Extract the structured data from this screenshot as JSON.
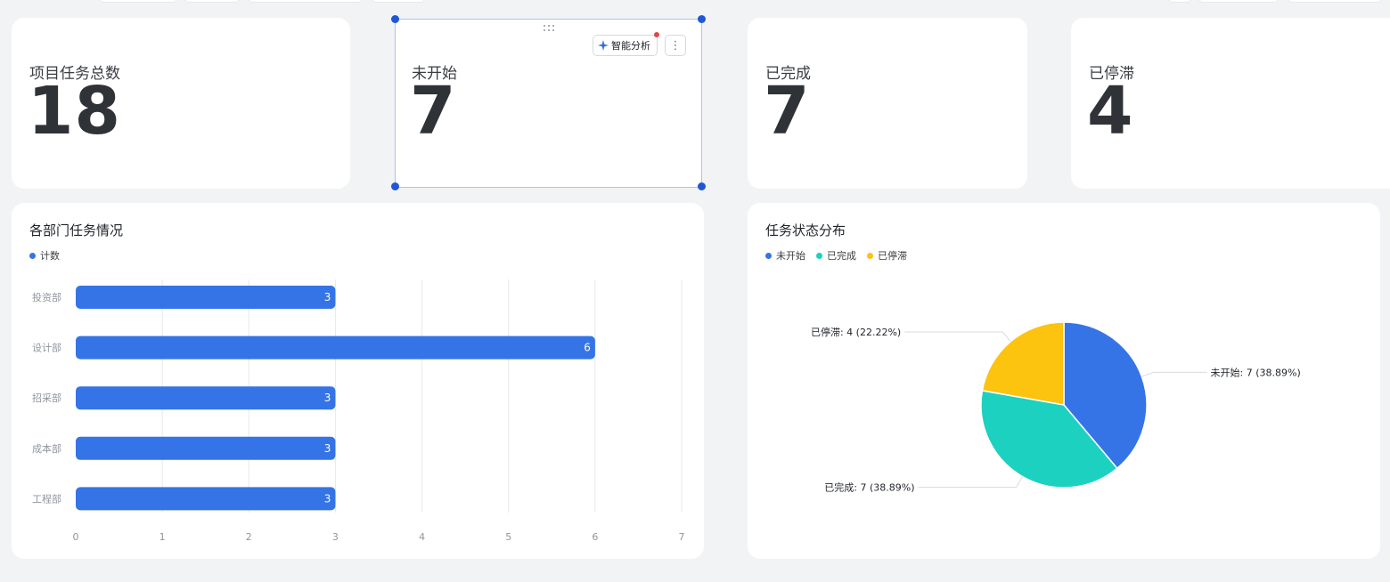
{
  "kpis": [
    {
      "title": "项目任务总数",
      "value": "18"
    },
    {
      "title": "未开始",
      "value": "7"
    },
    {
      "title": "已完成",
      "value": "7"
    },
    {
      "title": "已停滞",
      "value": "4"
    }
  ],
  "selected_card_toolbar": {
    "ai_label": "智能分析",
    "more_label": "⋮"
  },
  "colors": {
    "blue": "#3574e6",
    "teal": "#1dd1c1",
    "yellow": "#fcc30f"
  },
  "chart_data": [
    {
      "type": "bar",
      "title": "各部门任务情况",
      "orientation": "horizontal",
      "categories": [
        "投资部",
        "设计部",
        "招采部",
        "成本部",
        "工程部"
      ],
      "series": [
        {
          "name": "计数",
          "values": [
            3,
            6,
            3,
            3,
            3
          ]
        }
      ],
      "xticks": [
        "0",
        "1",
        "2",
        "3",
        "4",
        "5",
        "6",
        "7"
      ],
      "xlim": [
        0,
        7
      ],
      "grid": "vertical",
      "legend_position": "top-left",
      "data_labels": true
    },
    {
      "type": "pie",
      "title": "任务状态分布",
      "slices": [
        {
          "name": "未开始",
          "value": 7,
          "percent": "38.89%",
          "label": "未开始: 7 (38.89%)",
          "color": "#3574e6"
        },
        {
          "name": "已完成",
          "value": 7,
          "percent": "38.89%",
          "label": "已完成: 7 (38.89%)",
          "color": "#1dd1c1"
        },
        {
          "name": "已停滞",
          "value": 4,
          "percent": "22.22%",
          "label": "已停滞: 4 (22.22%)",
          "color": "#fcc30f"
        }
      ],
      "legend_position": "top-left"
    }
  ]
}
